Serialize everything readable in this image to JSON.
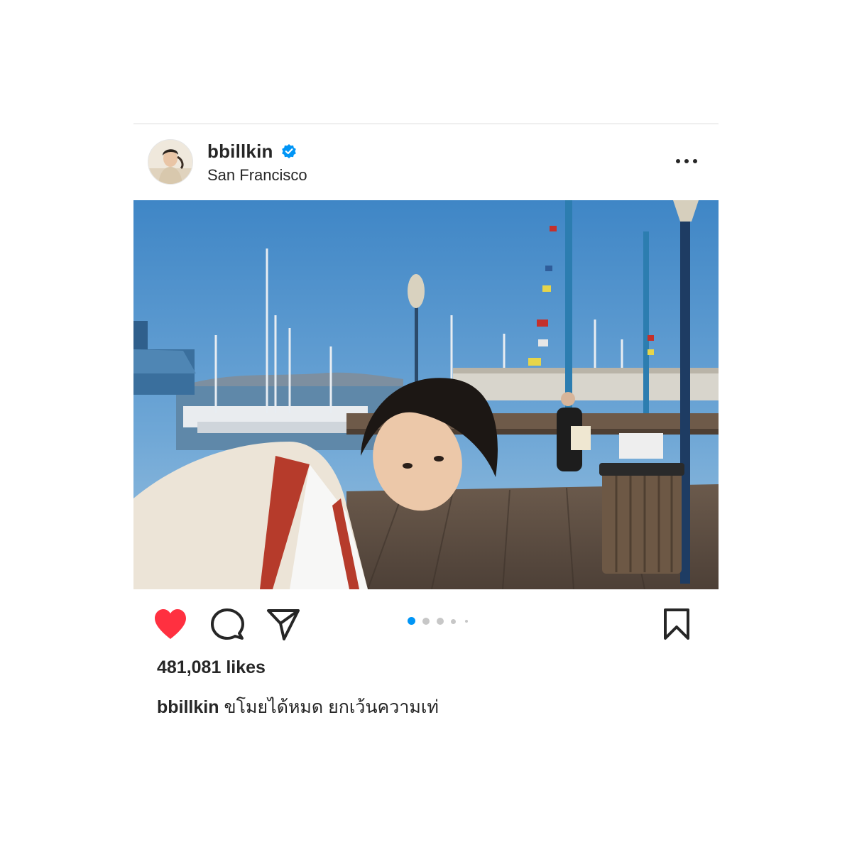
{
  "post": {
    "username": "bbillkin",
    "verified": true,
    "location": "San Francisco",
    "likes_text": "481,081 likes",
    "caption_user": "bbillkin",
    "caption_text": "ขโมยได้หมด ยกเว้นความเท่",
    "carousel": {
      "count": 5,
      "active_index": 0
    }
  },
  "icons": {
    "like": "heart-filled-icon",
    "comment": "comment-bubble-icon",
    "share": "paper-plane-icon",
    "save": "bookmark-icon",
    "more": "more-horizontal-icon",
    "verified": "verified-badge-icon"
  },
  "colors": {
    "like_red": "#ff3040",
    "verified_blue": "#0095f6",
    "active_dot": "#0095f6",
    "inactive_dot": "#c7c7c7",
    "text": "#262626"
  }
}
